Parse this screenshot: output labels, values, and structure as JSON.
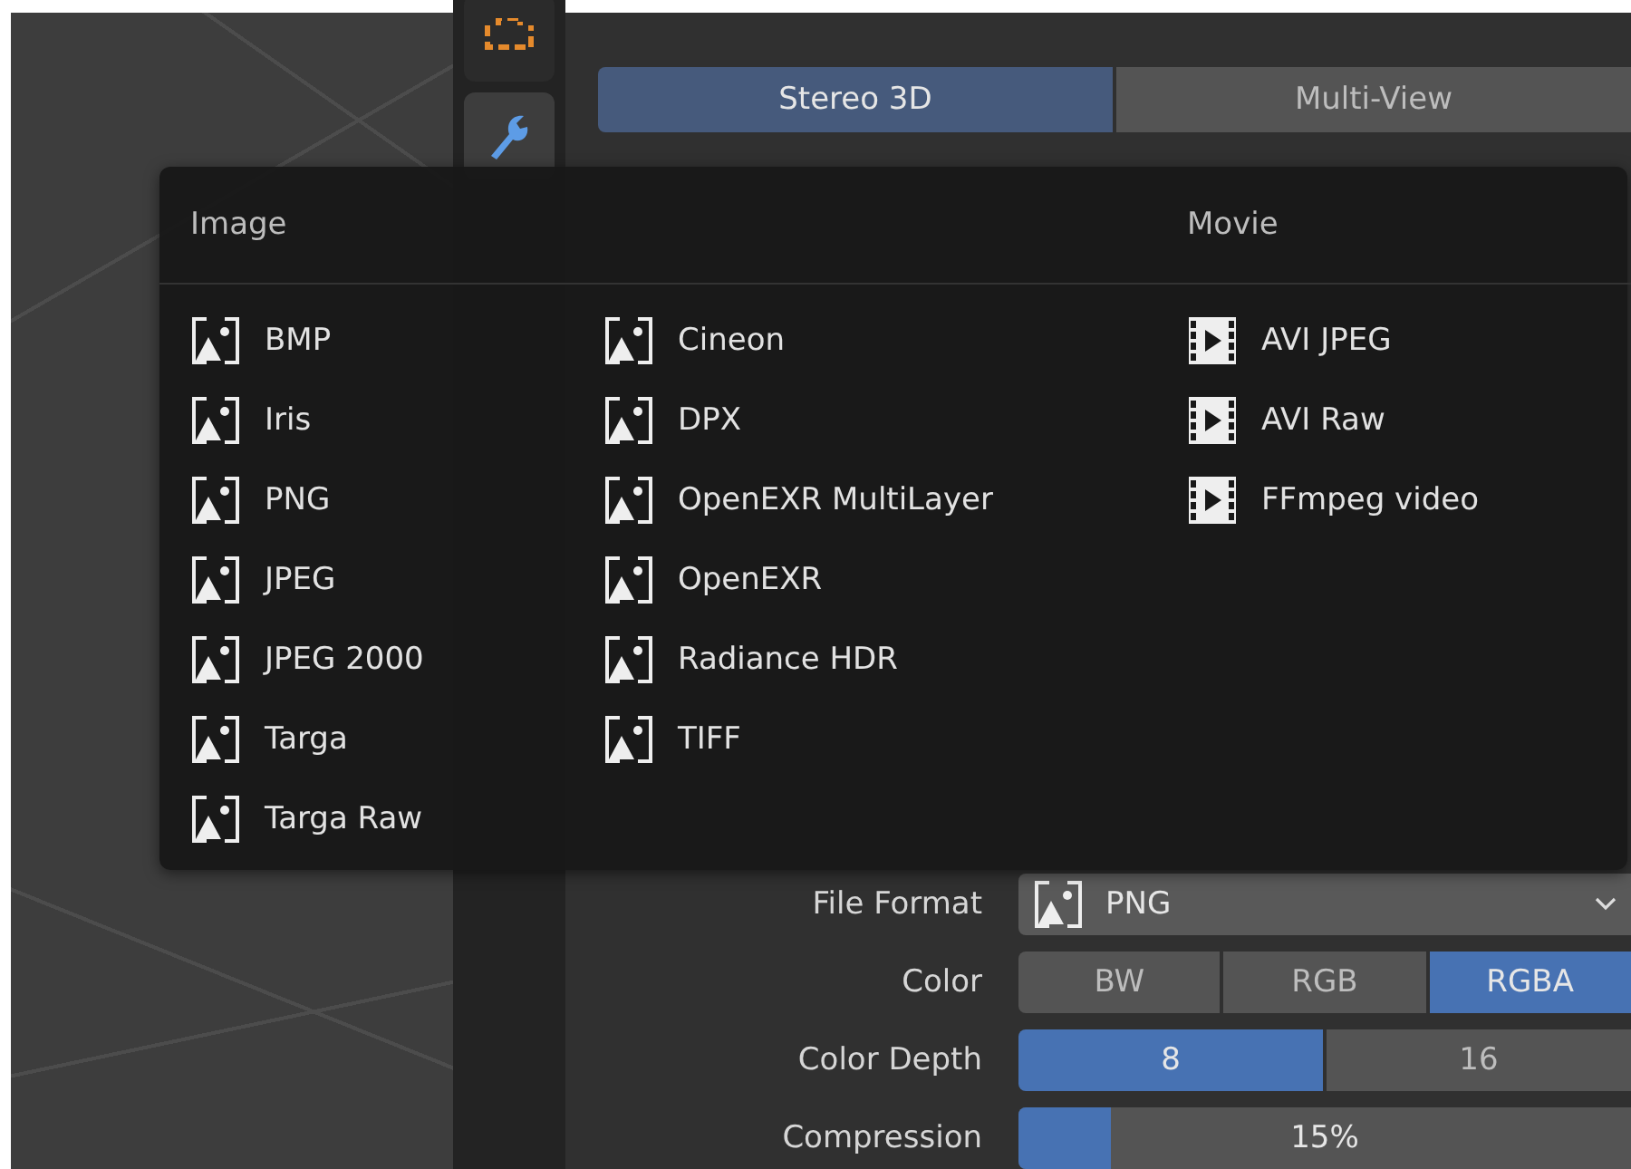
{
  "property_tabs": [
    {
      "kind": "output",
      "selected": false
    },
    {
      "kind": "modifier",
      "selected": true
    }
  ],
  "view_mode_tabs": [
    {
      "label": "Stereo 3D",
      "selected": true
    },
    {
      "label": "Multi-View",
      "selected": false
    }
  ],
  "format_menu": {
    "sections": [
      {
        "title": "Image",
        "kind": "image",
        "columns": [
          [
            "BMP",
            "Iris",
            "PNG",
            "JPEG",
            "JPEG 2000",
            "Targa",
            "Targa Raw"
          ],
          [
            "Cineon",
            "DPX",
            "OpenEXR MultiLayer",
            "OpenEXR",
            "Radiance HDR",
            "TIFF"
          ]
        ]
      },
      {
        "title": "Movie",
        "kind": "movie",
        "columns": [
          [
            "AVI JPEG",
            "AVI Raw",
            "FFmpeg video"
          ]
        ]
      }
    ]
  },
  "file_format": {
    "label": "File Format",
    "value": "PNG",
    "kind": "image"
  },
  "color": {
    "label": "Color",
    "options": [
      {
        "label": "BW",
        "selected": false
      },
      {
        "label": "RGB",
        "selected": false
      },
      {
        "label": "RGBA",
        "selected": true
      }
    ]
  },
  "color_depth": {
    "label": "Color Depth",
    "options": [
      {
        "label": "8",
        "selected": true
      },
      {
        "label": "16",
        "selected": false
      }
    ]
  },
  "compression": {
    "label": "Compression",
    "level": 0.15,
    "reading": "15%"
  }
}
